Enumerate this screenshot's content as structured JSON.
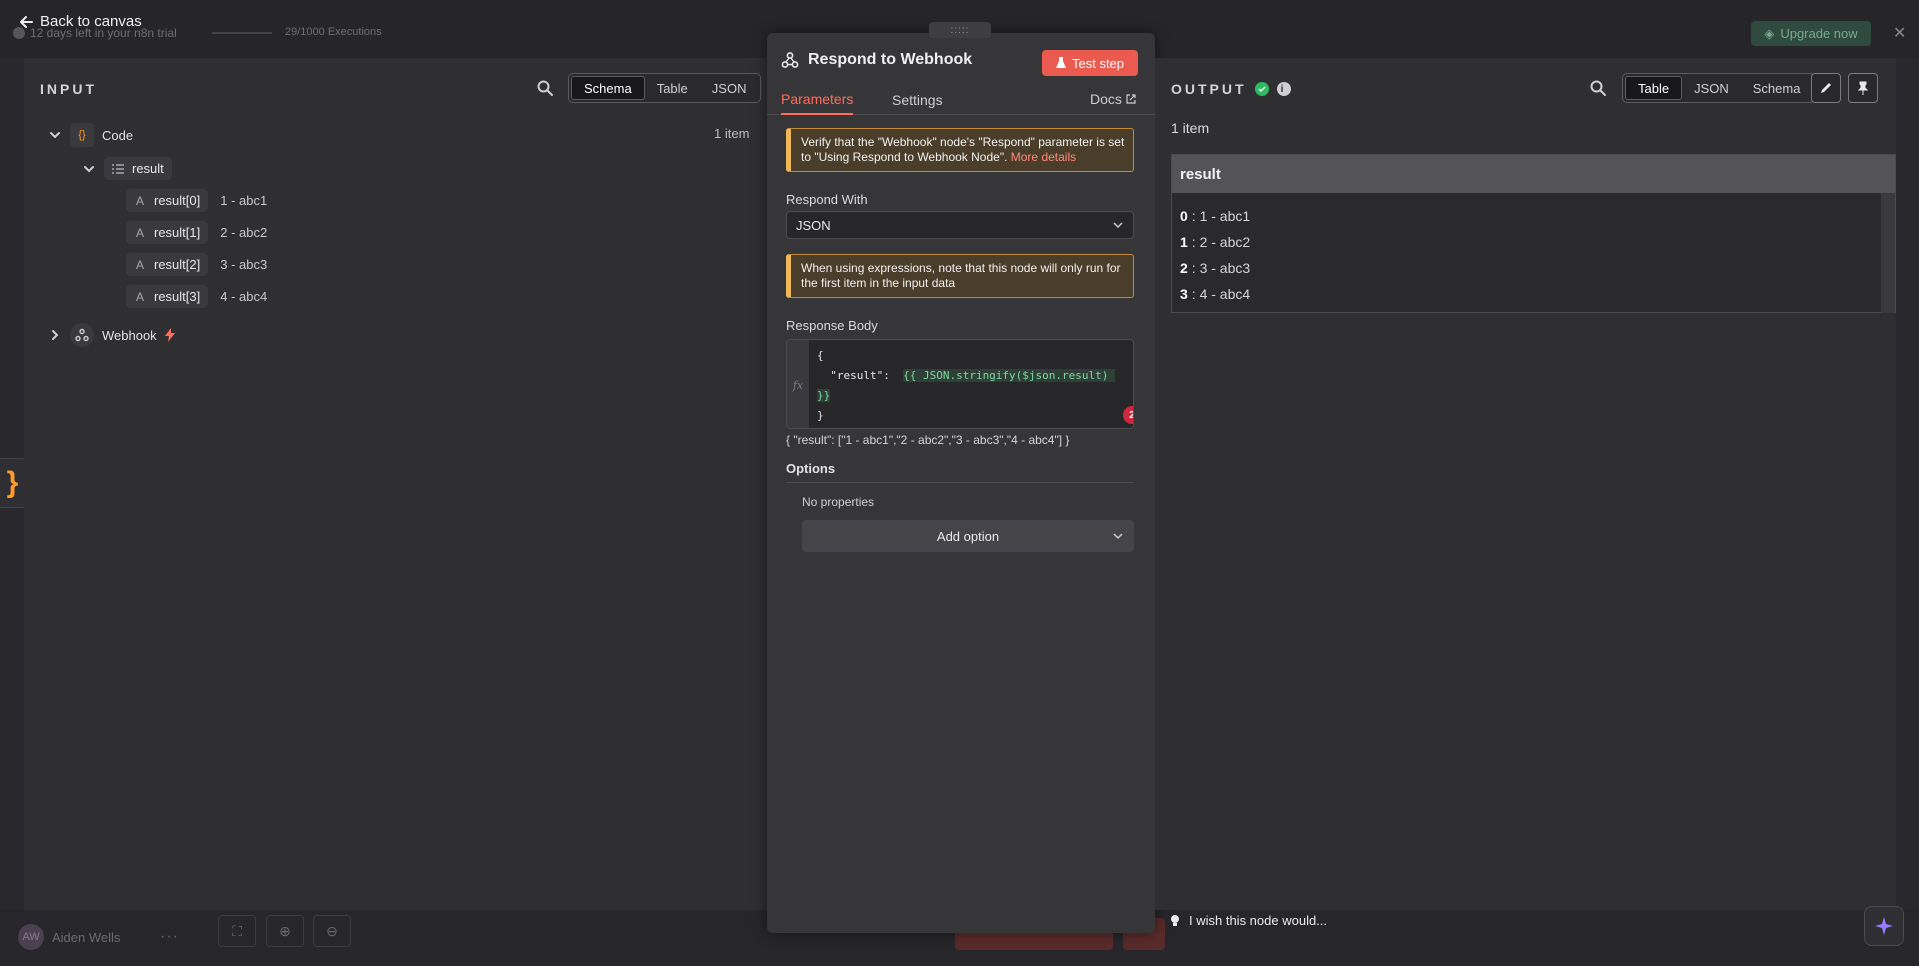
{
  "background": {
    "trial_text": "12 days left in your n8n trial",
    "executions_text": "29/1000 Executions",
    "upgrade_label": "Upgrade now",
    "user_initials": "AW",
    "user_name": "Aiden Wells"
  },
  "back_label": "Back to canvas",
  "input": {
    "title": "INPUT",
    "views": [
      "Schema",
      "Table",
      "JSON"
    ],
    "active_view": "Schema",
    "item_count": "1 item",
    "tree": {
      "code_node": "Code",
      "code_icon": "{}",
      "field": "result",
      "entries": [
        {
          "key": "result[0]",
          "value": "1 - abc1"
        },
        {
          "key": "result[1]",
          "value": "2 - abc2"
        },
        {
          "key": "result[2]",
          "value": "3 - abc3"
        },
        {
          "key": "result[3]",
          "value": "4 - abc4"
        }
      ],
      "type_letter": "A",
      "webhook_node": "Webhook"
    }
  },
  "node": {
    "title": "Respond to Webhook",
    "test_label": "Test step",
    "tabs": [
      "Parameters",
      "Settings"
    ],
    "docs_label": "Docs",
    "notice1_text": "Verify that the \"Webhook\" node's \"Respond\" parameter is set to \"Using Respond to Webhook Node\".",
    "notice1_link": "More details",
    "respond_with_label": "Respond With",
    "respond_with_value": "JSON",
    "notice2_text": "When using expressions, note that this node will only run for the first item in the input data",
    "response_body_label": "Response Body",
    "code_line1": "{",
    "code_line2_key": "  \"result\":  ",
    "code_line2_expr": "{{ JSON.stringify($json.result) ",
    "code_line3": "}}",
    "code_line4": "}",
    "fx_label": "fx",
    "error_count": "2",
    "preview": "{  \"result\":  [\"1 - abc1\",\"2 - abc2\",\"3 - abc3\",\"4 - abc4\"] }",
    "options_label": "Options",
    "no_properties": "No properties",
    "add_option_label": "Add option"
  },
  "output": {
    "title": "OUTPUT",
    "views": [
      "Table",
      "JSON",
      "Schema"
    ],
    "active_view": "Table",
    "item_count": "1 item",
    "column": "result",
    "rows": [
      {
        "index": "0",
        "value": ": 1 - abc1"
      },
      {
        "index": "1",
        "value": ": 2 - abc2"
      },
      {
        "index": "2",
        "value": ": 3 - abc3"
      },
      {
        "index": "3",
        "value": ": 4 - abc4"
      }
    ]
  },
  "feedback_text": "I wish this node would...",
  "colors": {
    "accent": "#ff6d5a",
    "success": "#2dba62",
    "warning_border": "#f2b857"
  }
}
